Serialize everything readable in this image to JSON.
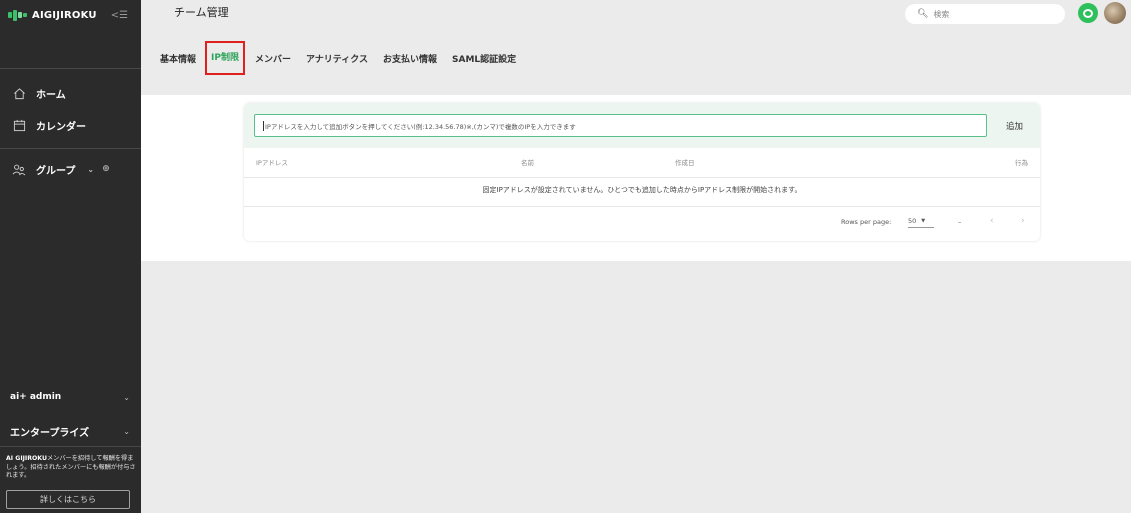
{
  "sidebar": {
    "logo_text": "AIGIJIROKU",
    "collapse_icon": "collapse-menu-icon",
    "nav": [
      {
        "label": "ホーム",
        "icon": "home-icon"
      },
      {
        "label": "カレンダー",
        "icon": "calendar-icon"
      },
      {
        "label": "グループ",
        "icon": "group-icon"
      }
    ],
    "workspace": "ai+ admin",
    "plan": "エンタープライズ",
    "promo_bold": "AI GIJIROKU",
    "promo_text": "メンバーを招待して報酬を得ましょう。招待されたメンバーにも報酬が付与されます。",
    "promo_button": "詳しくはこちら"
  },
  "header": {
    "title": "チーム管理",
    "search_placeholder": "検索"
  },
  "tabs": [
    {
      "label": "基本情報"
    },
    {
      "label": "IP制限",
      "active": true
    },
    {
      "label": "メンバー"
    },
    {
      "label": "アナリティクス"
    },
    {
      "label": "お支払い情報"
    },
    {
      "label": "SAML認証設定"
    }
  ],
  "ip_panel": {
    "input_placeholder": "IPアドレスを入力して追加ボタンを押してください(例:12.34.56.78)※,(カンマ)で複数のIPを入力できます",
    "add_button": "追加",
    "columns": [
      "IPアドレス",
      "名前",
      "作成日",
      "行為"
    ],
    "empty_message": "固定IPアドレスが設定されていません。ひとつでも追加した時点からIPアドレス制限が開始されます。",
    "rows_per_page_label": "Rows per page:",
    "rows_per_page_value": "50",
    "page_range": "–"
  },
  "colors": {
    "sidebar_bg": "#2b2b2b",
    "accent_green": "#2ea45a",
    "highlight_red": "#e01f1f",
    "input_border": "#5bbf8a"
  }
}
